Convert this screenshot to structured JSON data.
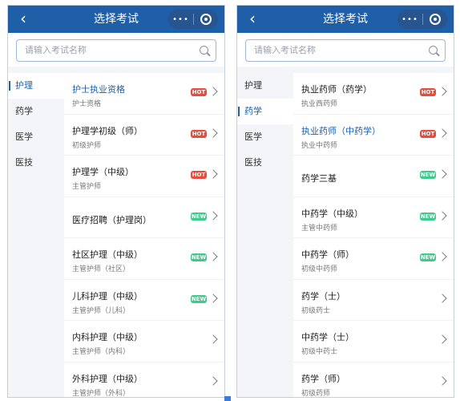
{
  "left": {
    "title": "选择考试",
    "search_placeholder": "请输入考试名称",
    "tabs": [
      "护理",
      "药学",
      "医学",
      "医技"
    ],
    "items": [
      {
        "title": "护士执业资格",
        "sub": "护士资格",
        "badge": "HOT",
        "active": true
      },
      {
        "title": "护理学初级（师）",
        "sub": "初级护师",
        "badge": "HOT"
      },
      {
        "title": "护理学（中级）",
        "sub": "主管护师",
        "badge": "HOT"
      },
      {
        "title": "医疗招聘（护理岗）",
        "sub": "",
        "badge": "NEW"
      },
      {
        "title": "社区护理（中级）",
        "sub": "主管护师（社区）",
        "badge": "NEW"
      },
      {
        "title": "儿科护理（中级）",
        "sub": "主管护师（儿科）",
        "badge": "NEW"
      },
      {
        "title": "内科护理（中级）",
        "sub": "主管护师（内科）",
        "badge": ""
      },
      {
        "title": "外科护理（中级）",
        "sub": "主管护师（外科）",
        "badge": ""
      }
    ]
  },
  "right": {
    "title": "选择考试",
    "search_placeholder": "请输入考试名称",
    "tabs": [
      "护理",
      "药学",
      "医学",
      "医技"
    ],
    "items": [
      {
        "title": "执业药师（药学）",
        "sub": "执业西药师",
        "badge": "HOT"
      },
      {
        "title": "执业药师（中药学）",
        "sub": "执业中药师",
        "badge": "HOT",
        "active": true
      },
      {
        "title": "药学三基",
        "sub": "",
        "badge": "NEW"
      },
      {
        "title": "中药学（中级）",
        "sub": "主管中药师",
        "badge": "NEW"
      },
      {
        "title": "中药学（师）",
        "sub": "初级中药师",
        "badge": "NEW"
      },
      {
        "title": "药学（士）",
        "sub": "初级药士",
        "badge": ""
      },
      {
        "title": "中药学（士）",
        "sub": "初级中药士",
        "badge": ""
      },
      {
        "title": "药学（师）",
        "sub": "初级药师",
        "badge": ""
      }
    ]
  },
  "colors": {
    "brand": "#1e5fa8",
    "hot": "#e64b3c",
    "new": "#3fc98a"
  }
}
